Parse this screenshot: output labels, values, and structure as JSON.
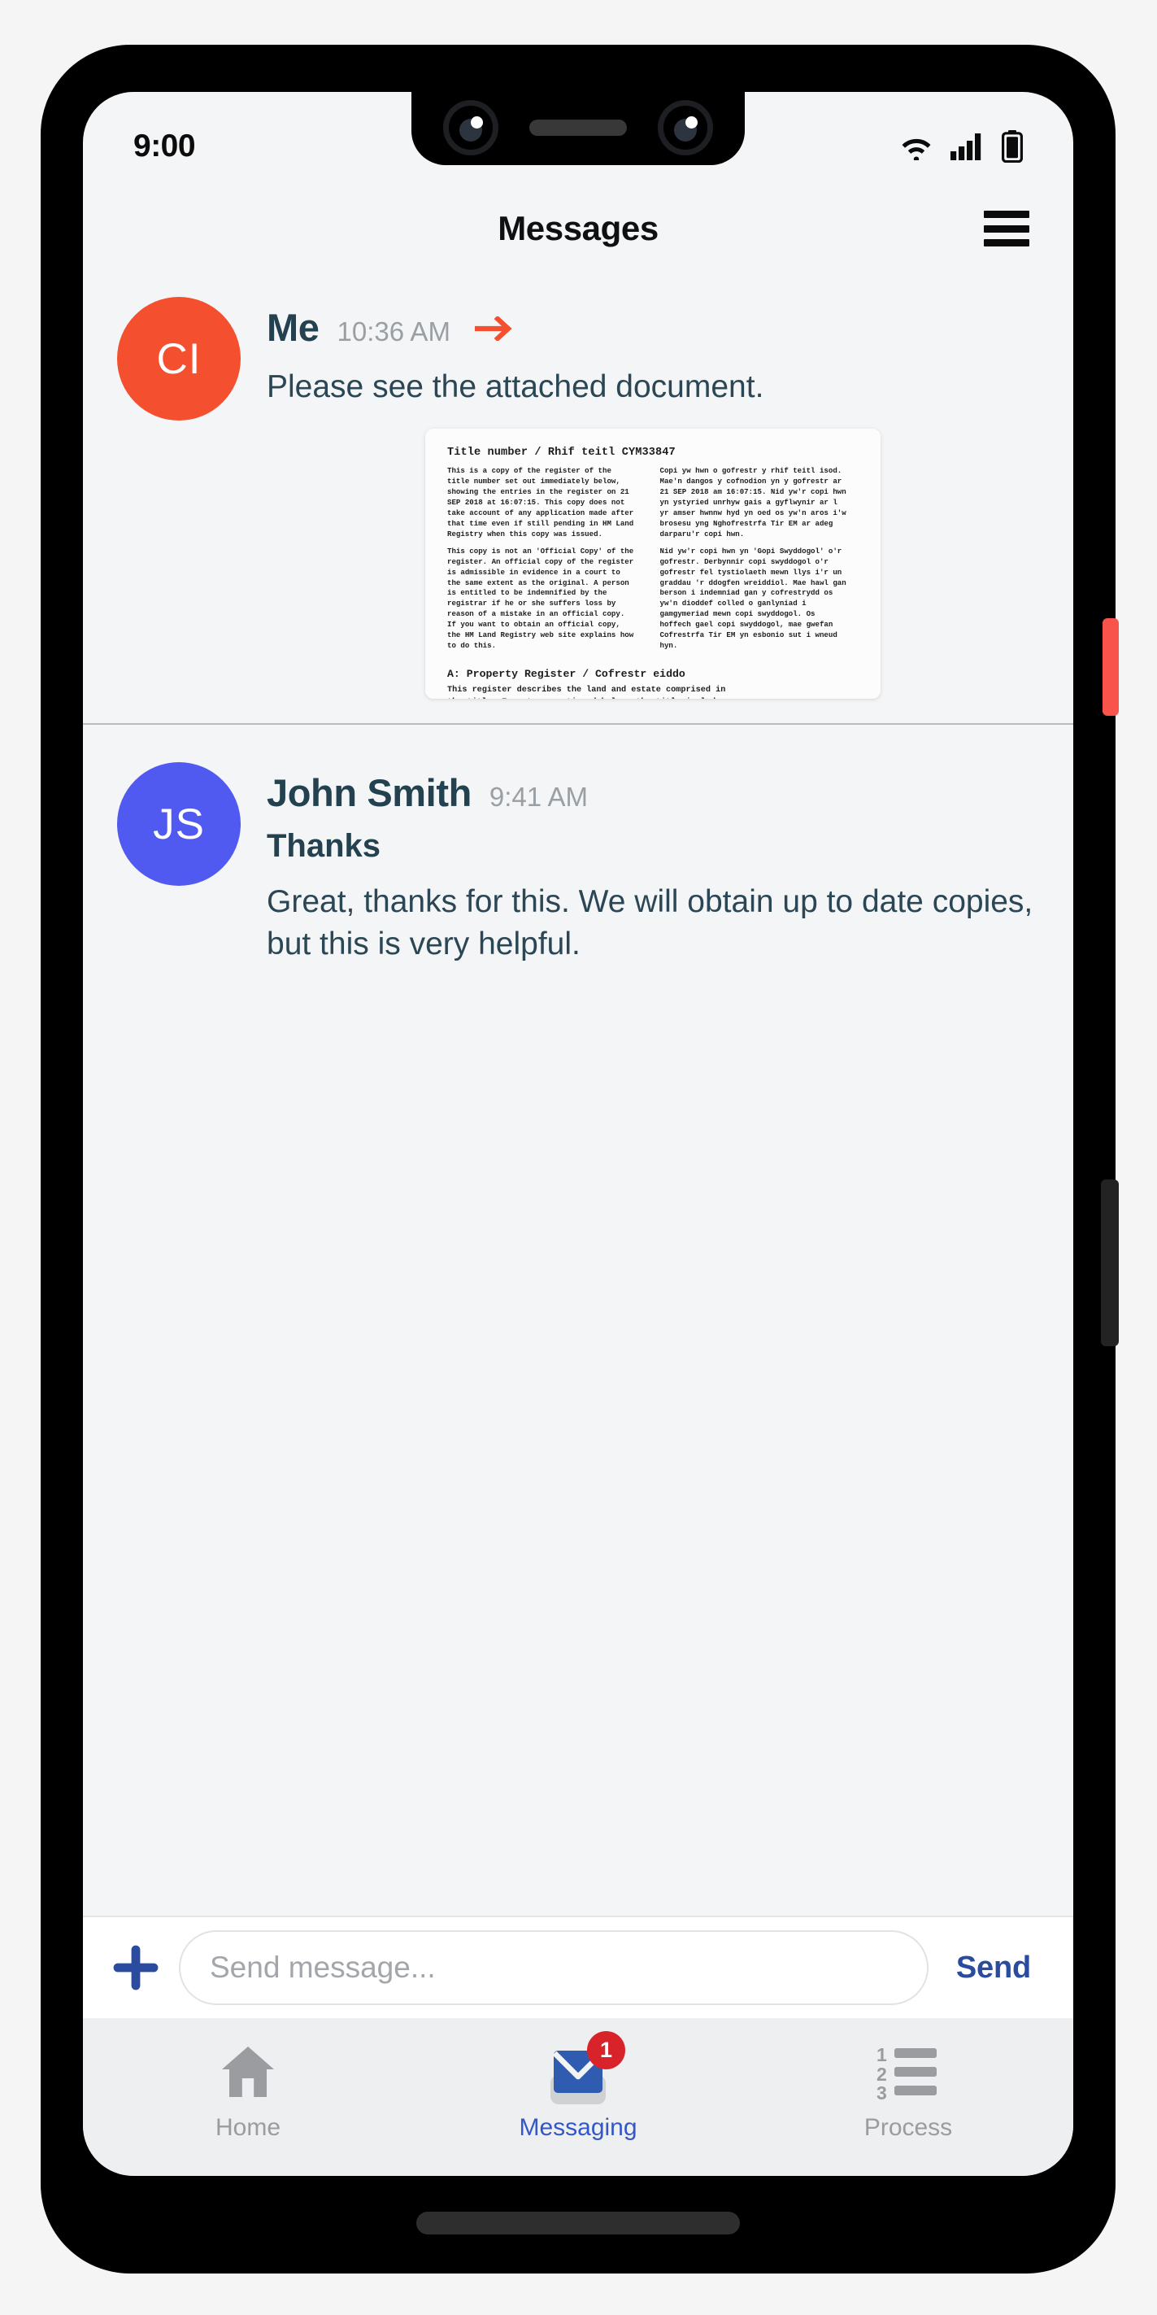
{
  "status_bar": {
    "time": "9:00",
    "icons": [
      "wifi-icon",
      "cellular-signal-icon",
      "battery-icon"
    ]
  },
  "header": {
    "title": "Messages",
    "menu_icon": "hamburger-menu-icon"
  },
  "colors": {
    "avatar_me": "#f4502f",
    "avatar_john": "#5059f0",
    "sent_arrow": "#f4502f",
    "accent_blue": "#2b4b9e",
    "nav_active": "#3557c6",
    "badge_red": "#d9232a",
    "text_primary": "#23414f",
    "text_muted": "#9a9fa3",
    "screen_bg": "#f4f5f6"
  },
  "messages": [
    {
      "avatar_initials": "CI",
      "sender": "Me",
      "time": "10:36 AM",
      "sent_indicator": "arrow-right-icon",
      "text": "Please see the attached document.",
      "attachment": {
        "type": "document-thumbnail",
        "title": "Title number / Rhif teitl  CYM33847",
        "columns": [
          {
            "paragraphs": [
              "This is a copy of the register of the\ntitle number set out immediately below,\nshowing the entries in the register on 21\nSEP 2018 at 16:07:15. This copy does not\ntake account of any application made after\nthat time even if still pending in HM Land\nRegistry when this copy was issued.",
              "This copy is not an 'Official Copy' of the\nregister. An official copy of the register\nis admissible in evidence in a court to\nthe same extent as the original. A person\nis entitled to be indemnified by the\nregistrar if he or she suffers loss by\nreason of a mistake in an official copy.\nIf you want to obtain an official copy,\nthe HM Land Registry web site explains how\nto do this."
            ]
          },
          {
            "paragraphs": [
              "Copi yw hwn o gofrestr y rhif teitl isod.\nMae'n dangos y cofnodion yn y gofrestr ar\n21 SEP 2018 am 16:07:15. Nid yw'r copi hwn\nyn ystyried unrhyw gais a gyflwynir ar l\nyr amser hwnnw hyd yn oed os yw'n aros i'w\nbrosesu yng Nghofrestrfa Tir EM ar adeg\ndarparu'r copi hwn.",
              "Nid yw'r copi hwn yn 'Gopi Swyddogol' o'r\ngofrestr.  Derbynnir copi swyddogol o'r\ngofrestr fel tystiolaeth mewn llys i'r un\ngraddau 'r ddogfen wreiddiol. Mae hawl gan\nberson i indemniad gan y cofrestrydd os\nyw'n dioddef colled o ganlyniad i\ngamgymeriad mewn copi swyddogol. Os\nhoffech gael copi swyddogol, mae gwefan\nCofrestrfa Tir EM yn esbonio sut i wneud\nhyn."
            ]
          }
        ],
        "section_title": "A: Property Register / Cofrestr eiddo",
        "section_body": "This register describes the land and estate comprised in\nthe title. Except as mentioned below, the title includes\nany legal easements granted by the registered lease but\nis subject to any rights that it reserves, so far as"
      }
    },
    {
      "avatar_initials": "JS",
      "sender": "John Smith",
      "time": "9:41 AM",
      "subject": "Thanks",
      "text": "Great, thanks for this. We will obtain up to date copies, but this is very helpful."
    }
  ],
  "composer": {
    "add_icon": "plus-icon",
    "placeholder": "Send message...",
    "value": "",
    "send_label": "Send"
  },
  "bottom_nav": {
    "items": [
      {
        "label": "Home",
        "icon": "home-icon",
        "active": false,
        "badge": ""
      },
      {
        "label": "Messaging",
        "icon": "envelope-icon",
        "active": true,
        "badge": "1"
      },
      {
        "label": "Process",
        "icon": "numbered-list-icon",
        "active": false,
        "badge": ""
      }
    ]
  }
}
